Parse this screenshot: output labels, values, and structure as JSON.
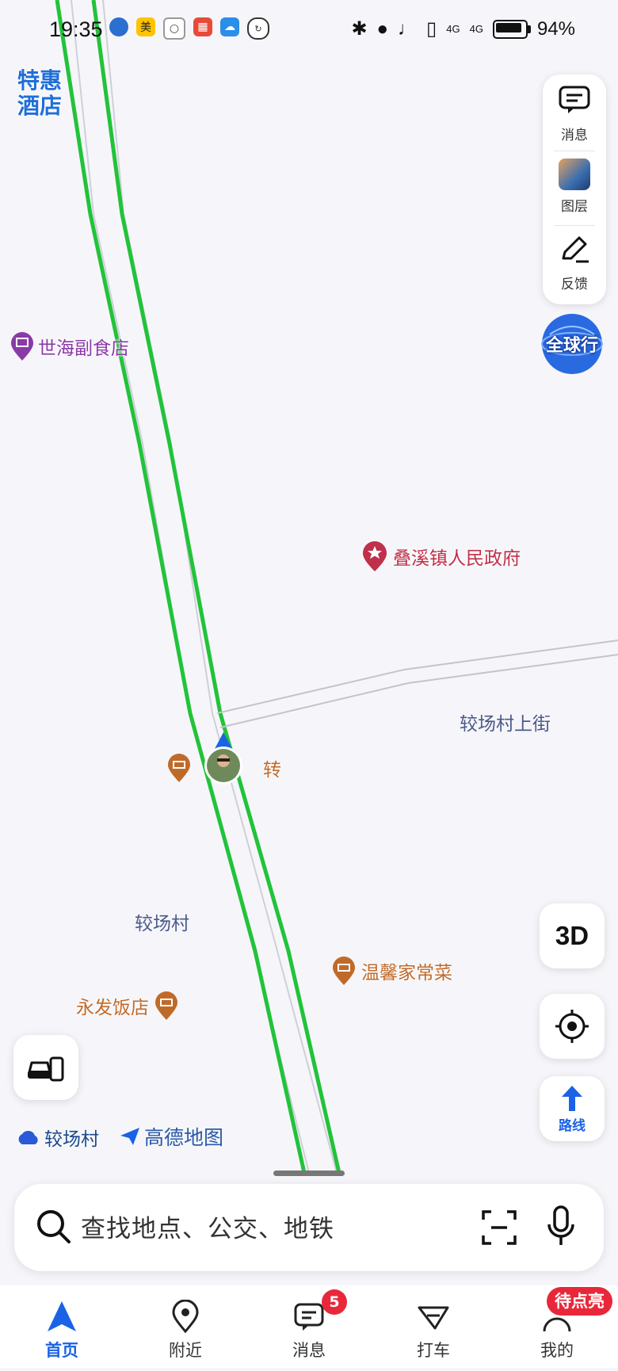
{
  "status_bar": {
    "time": "19:35",
    "app_badge_text": "美",
    "network_1": "4G",
    "network_2": "4G",
    "battery": "94%"
  },
  "map": {
    "hotel_badge": {
      "line1": "特惠",
      "line2": "酒店"
    },
    "global_button": "全球行",
    "pois": [
      {
        "name": "世海副食店",
        "type": "shop",
        "color": "#8a3aa8"
      },
      {
        "name": "叠溪镇人民政府",
        "type": "government",
        "color": "#c0304a"
      },
      {
        "name": "转",
        "type": "restaurant",
        "color": "#c06a2a"
      },
      {
        "name": "温馨家常菜",
        "type": "restaurant",
        "color": "#c06a2a"
      },
      {
        "name": "永发饭店",
        "type": "restaurant",
        "color": "#c06a2a"
      }
    ],
    "area_labels": [
      "较场村上街",
      "较场村"
    ],
    "weather": "较场村",
    "watermark": "高德地图"
  },
  "right_panel": {
    "items": [
      {
        "label": "消息",
        "icon": "message-icon"
      },
      {
        "label": "图层",
        "icon": "layers-avatar"
      },
      {
        "label": "反馈",
        "icon": "feedback-pencil-icon"
      }
    ]
  },
  "controls": {
    "three_d": "3D",
    "route": "路线"
  },
  "search": {
    "placeholder": "查找地点、公交、地铁"
  },
  "tabbar": {
    "tabs": [
      {
        "label": "首页",
        "active": true
      },
      {
        "label": "附近",
        "active": false
      },
      {
        "label": "消息",
        "active": false
      },
      {
        "label": "打车",
        "active": false
      },
      {
        "label": "我的",
        "active": false
      }
    ],
    "message_badge": "5",
    "promo_badge": "待点亮"
  },
  "colors": {
    "accent": "#1a63e6",
    "route_green": "#22c33a",
    "badge_red": "#e8283a"
  }
}
